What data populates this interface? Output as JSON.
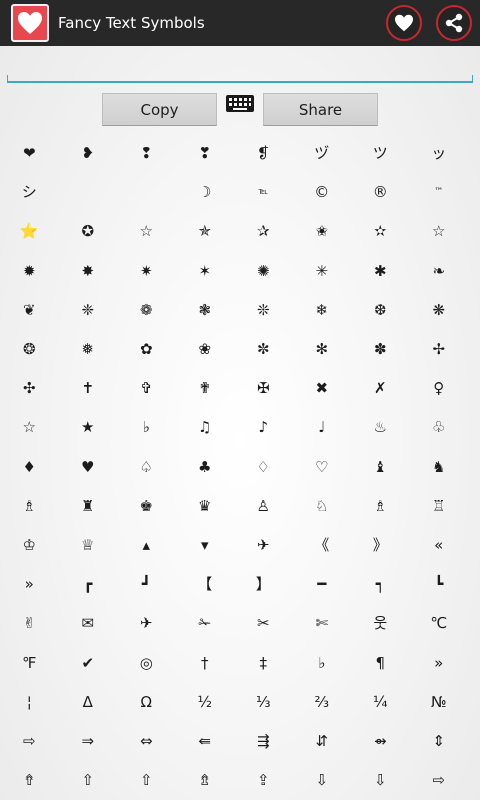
{
  "app": {
    "title": "Fancy Text Symbols"
  },
  "toolbar": {
    "favorite_icon": "heart-icon",
    "share_icon": "share-icon"
  },
  "input": {
    "value": "",
    "placeholder": ""
  },
  "buttons": {
    "copy": "Copy",
    "share": "Share"
  },
  "colors": {
    "action_bar": "#282828",
    "accent_red": "#c9272d",
    "app_icon_bg": "#e8474e",
    "input_underline": "#38a9c9"
  },
  "symbols": [
    "❤",
    "❥",
    "❢",
    "❣",
    "❡",
    "ヅ",
    "ツ",
    "ッ",
    "シ",
    "",
    "",
    "☽",
    "℡",
    "©",
    "®",
    "™",
    "⭐",
    "✪",
    "☆",
    "✯",
    "✰",
    "✬",
    "✫",
    "☆",
    "✹",
    "✸",
    "✷",
    "✶",
    "✺",
    "✳",
    "✱",
    "❧",
    "❦",
    "❈",
    "❁",
    "❃",
    "❊",
    "❄",
    "❆",
    "❋",
    "❂",
    "❅",
    "✿",
    "❀",
    "✼",
    "✻",
    "✽",
    "✢",
    "✣",
    "✝",
    "✞",
    "✟",
    "✠",
    "✖",
    "✗",
    "♀",
    "☆",
    "★",
    "♭",
    "♫",
    "♪",
    "♩",
    "♨",
    "♧",
    "♦",
    "♥",
    "♤",
    "♣",
    "♢",
    "♡",
    "♝",
    "♞",
    "♗",
    "♜",
    "♚",
    "♛",
    "♙",
    "♘",
    "♗",
    "♖",
    "♔",
    "♕",
    "▴",
    "▾",
    "✈",
    "《",
    "》",
    "«",
    "»",
    "┏",
    "┛",
    "【",
    "】",
    "━",
    "┑",
    "┗",
    "✌",
    "✉",
    "✈",
    "✁",
    "✂",
    "✄",
    "웃",
    "℃",
    "℉",
    "✔",
    "◎",
    "†",
    "‡",
    "♭",
    "¶",
    "»",
    "¦",
    "Δ",
    "Ω",
    "½",
    "⅓",
    "⅔",
    "¼",
    "№",
    "⇨",
    "⇒",
    "⇔",
    "⇚",
    "⇶",
    "⇵",
    "⇴",
    "⇕",
    "⇮",
    "⇧",
    "⇧",
    "⇯",
    "⇪",
    "⇩",
    "⇩",
    "⇨"
  ]
}
